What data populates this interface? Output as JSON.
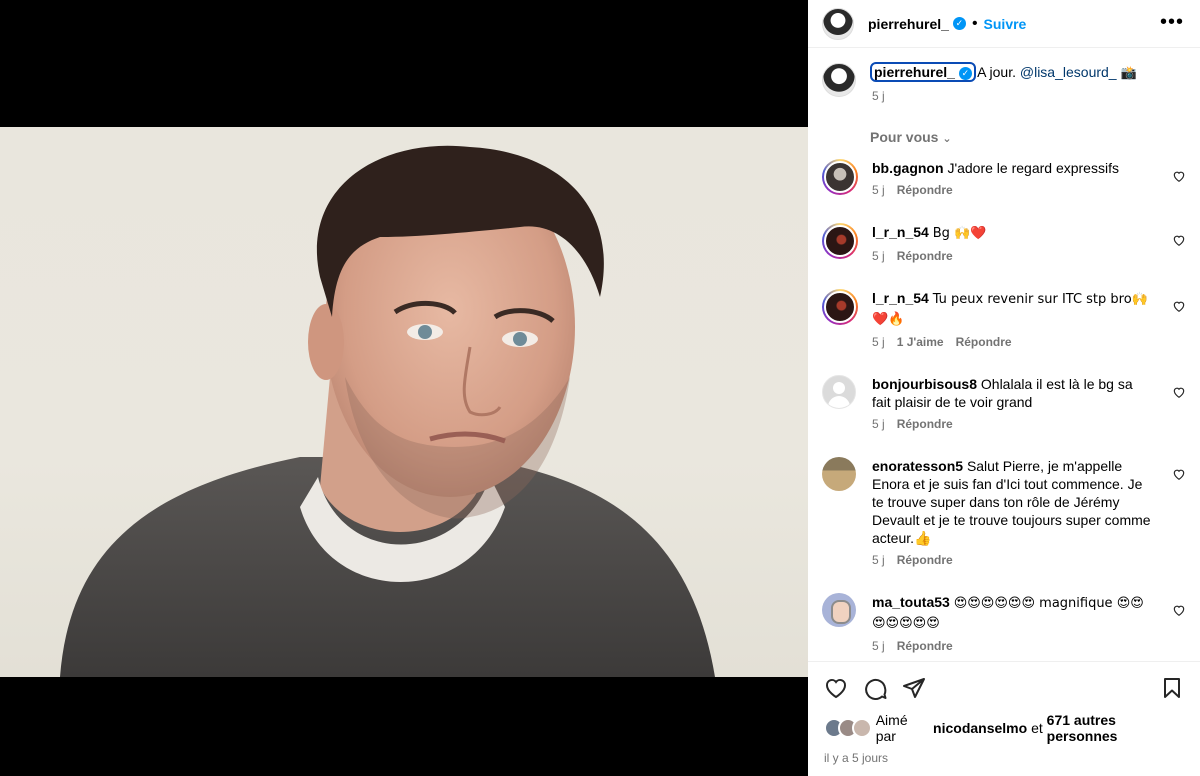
{
  "header": {
    "username": "pierrehurel_",
    "verified_mark": "✓",
    "follow_label": "Suivre",
    "more_label": "•••"
  },
  "caption": {
    "username": "pierrehurel_",
    "text": "A jour. ",
    "mention": "@lisa_lesourd_",
    "emoji": "📸",
    "time": "5 j"
  },
  "section_label": "Pour vous",
  "comments": [
    {
      "username": "bb.gagnon",
      "text": "J'adore le regard expressifs",
      "time": "5 j",
      "reply": "Répondre",
      "likes": ""
    },
    {
      "username": "l_r_n_54",
      "text": "Bg 🙌❤️",
      "time": "5 j",
      "reply": "Répondre",
      "likes": ""
    },
    {
      "username": "l_r_n_54",
      "text": "Tu peux revenir sur ITC stp bro🙌❤️🔥",
      "time": "5 j",
      "reply": "Répondre",
      "likes": "1 J'aime"
    },
    {
      "username": "bonjourbisous8",
      "text": "Ohlalala il est là le bg sa fait plaisir de te voir grand",
      "time": "5 j",
      "reply": "Répondre",
      "likes": ""
    },
    {
      "username": "enoratesson5",
      "text": "Salut Pierre, je m'appelle Enora et je suis fan d'Ici tout commence. Je te trouve super dans ton rôle de Jérémy Devault et je te trouve toujours super comme acteur.👍",
      "time": "5 j",
      "reply": "Répondre",
      "likes": ""
    },
    {
      "username": "ma_touta53",
      "text": "😍😍😍😍😍😍 magnifique 😍😍😍😍😍😍😍",
      "time": "5 j",
      "reply": "Répondre",
      "likes": ""
    }
  ],
  "footer": {
    "liked_prefix": "Aimé par ",
    "liked_user": "nicodanselmo",
    "liked_mid": " et ",
    "liked_count": "671 autres personnes",
    "date": "il y a 5 jours"
  },
  "icons": {
    "like": "heart-icon",
    "comment": "comment-icon",
    "share": "share-icon",
    "save": "bookmark-icon"
  }
}
